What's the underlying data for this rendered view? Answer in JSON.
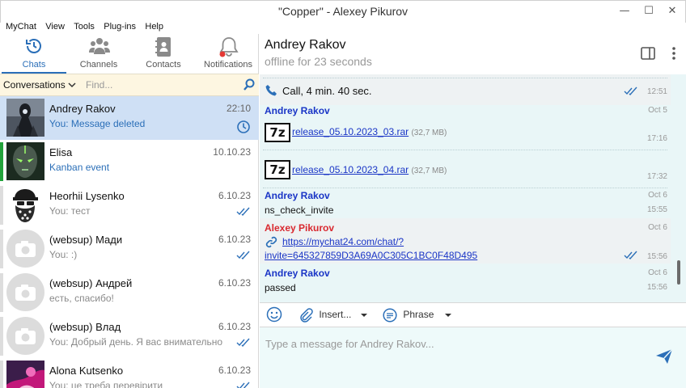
{
  "window": {
    "title": "\"Copper\" - Alexey Pikurov",
    "minimize": "—",
    "maximize": "☐",
    "close": "✕"
  },
  "menu": [
    "MyChat",
    "View",
    "Tools",
    "Plug-ins",
    "Help"
  ],
  "nav": {
    "tabs": [
      {
        "label": "Chats",
        "icon": "clock-history-icon",
        "active": true
      },
      {
        "label": "Channels",
        "icon": "people-group-icon",
        "active": false
      },
      {
        "label": "Contacts",
        "icon": "address-book-icon",
        "active": false
      },
      {
        "label": "Notifications",
        "icon": "bell-icon",
        "active": false,
        "badge_color": "#e53935"
      }
    ]
  },
  "conversations": {
    "label": "Conversations",
    "search_placeholder": "Find..."
  },
  "chats": [
    {
      "name": "Andrey Rakov",
      "preview": "You: Message deleted",
      "date": "22:10",
      "status": "clock-icon",
      "selected": true,
      "stripe": "",
      "avatar": "dark-figure"
    },
    {
      "name": "Elisa",
      "preview": "Kanban event",
      "date": "10.10.23",
      "status": "",
      "selected": false,
      "stripe": "#22a33a",
      "avatar": "robot-face"
    },
    {
      "name": "Heorhii Lysenko",
      "preview": "You: тест",
      "date": "6.10.23",
      "status": "double-check-icon",
      "selected": false,
      "stripe": "#dddddd",
      "avatar": "bearded-cartoon"
    },
    {
      "name": "(websup) Мади",
      "preview": "You: :)",
      "date": "6.10.23",
      "status": "double-check-icon",
      "selected": false,
      "stripe": "#dddddd",
      "avatar": "camera-placeholder"
    },
    {
      "name": "(websup) Андрей",
      "preview": "есть, спасибо!",
      "date": "6.10.23",
      "status": "",
      "selected": false,
      "stripe": "#dddddd",
      "avatar": "camera-placeholder"
    },
    {
      "name": "(websup) Влад",
      "preview": "You: Добрый день. Я вас внимательно",
      "date": "6.10.23",
      "status": "double-check-icon",
      "selected": false,
      "stripe": "#dddddd",
      "avatar": "camera-placeholder"
    },
    {
      "name": "Alona Kutsenko",
      "preview": "You: це треба перевірити",
      "date": "6.10.23",
      "status": "double-check-icon",
      "selected": false,
      "stripe": "#dddddd",
      "avatar": "purple-art"
    }
  ],
  "chat": {
    "name": "Andrey Rakov",
    "status": "offline for 23 seconds"
  },
  "messages": {
    "call": {
      "text": "Call, 4 min. 40 sec.",
      "time": "12:51"
    },
    "m1": {
      "author": "Andrey Rakov",
      "date": "Oct 5",
      "file": "release_05.10.2023_03.rar",
      "size": "(32,7 MB)",
      "time": "17:16"
    },
    "m2": {
      "file": "release_05.10.2023_04.rar",
      "size": "(32,7 MB)",
      "time": "17:32"
    },
    "m3": {
      "author": "Andrey Rakov",
      "date": "Oct 6",
      "text": "ns_check_invite",
      "time": "15:55"
    },
    "m4": {
      "author": "Alexey Pikurov",
      "date": "Oct 6",
      "link1": "https://mychat24.com/chat/?",
      "link2": "invite=645327859D3A69A0C305C1BC0F48D495",
      "time": "15:56"
    },
    "m5": {
      "author": "Andrey Rakov",
      "date": "Oct 6",
      "text": "passed",
      "time": "15:56"
    }
  },
  "toolbar": {
    "insert": "Insert...",
    "phrase": "Phrase"
  },
  "composer": {
    "placeholder": "Type a message for Andrey Rakov..."
  },
  "colors": {
    "accent": "#2b6fb8",
    "author_blue": "#1a35c6",
    "author_red": "#d9282f",
    "messages_bg": "#e9f6f7"
  }
}
